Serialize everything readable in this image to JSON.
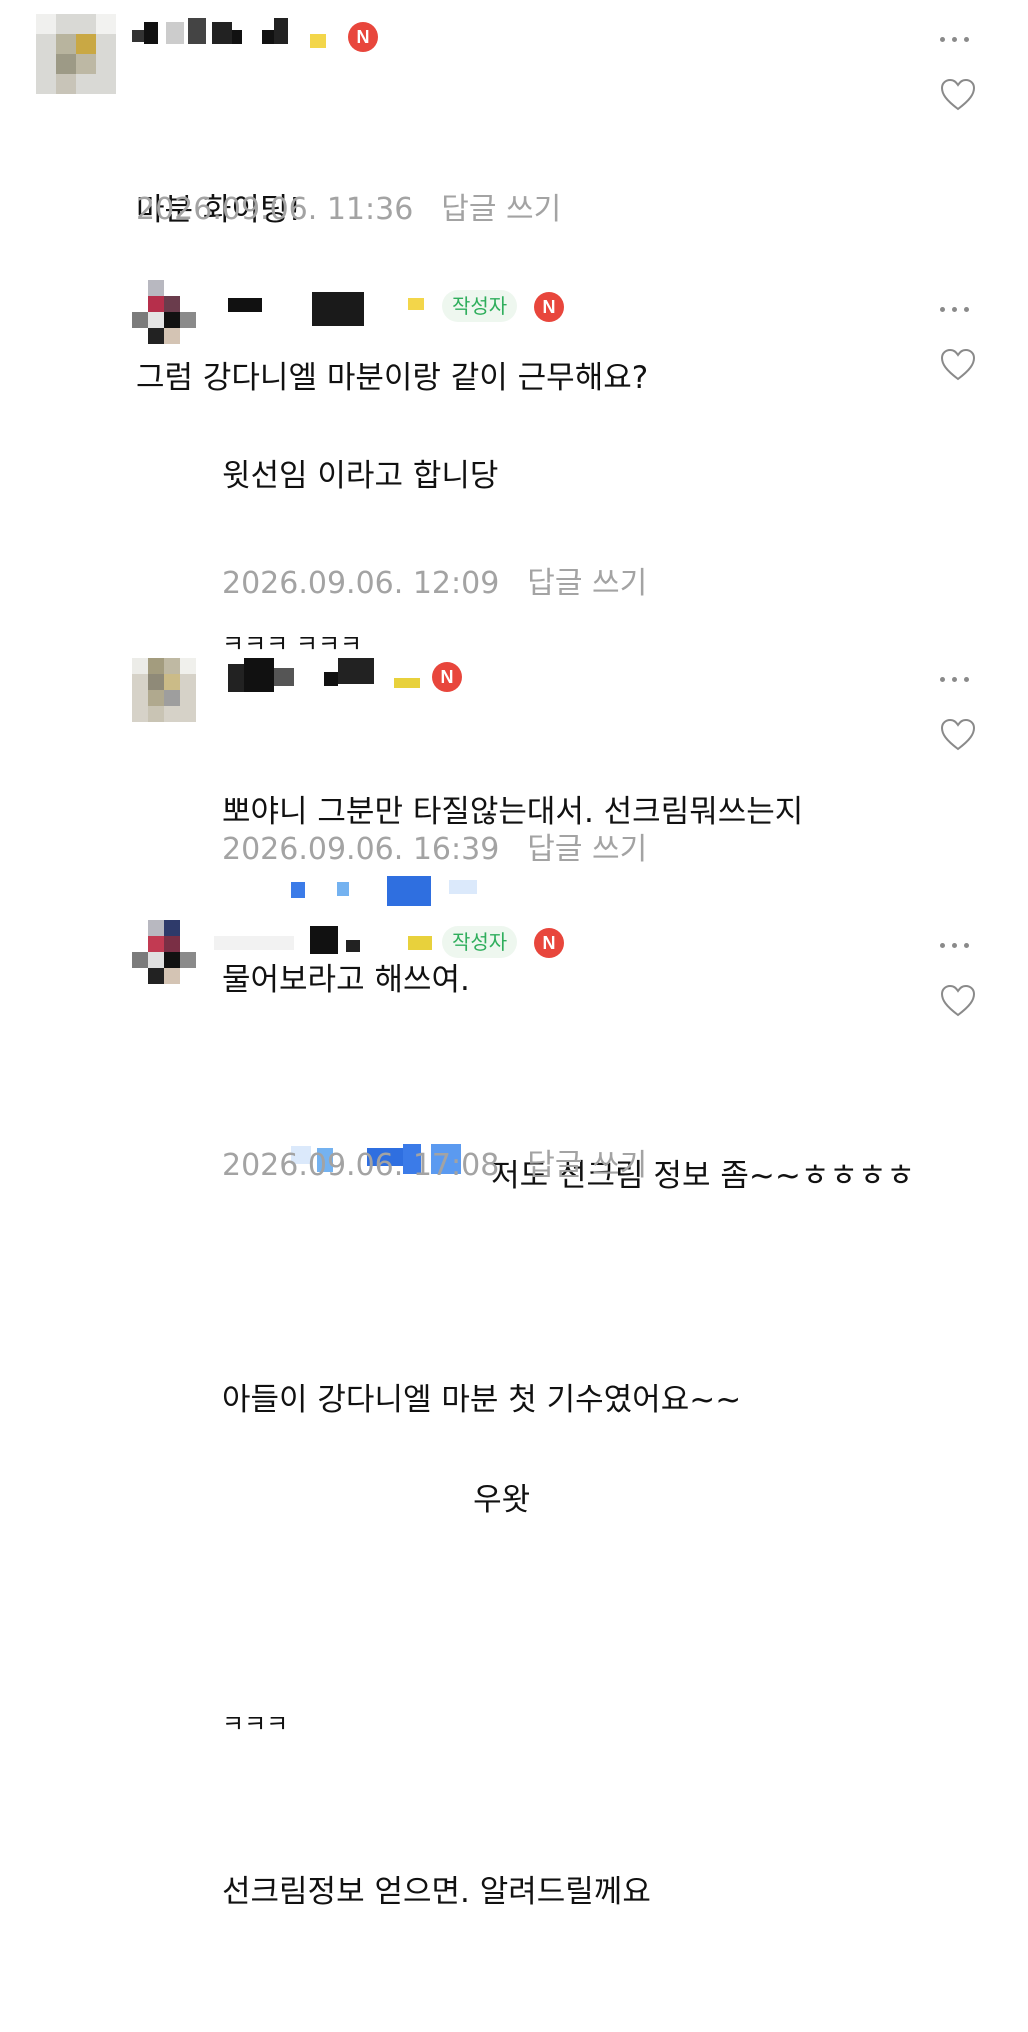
{
  "comments": [
    {
      "lines": [
        "마분 화이팅!",
        "그럼 강다니엘 마분이랑 같이 근무해요?"
      ],
      "timestamp": "2026.09.06. 11:36",
      "reply_label": "답글 쓰기",
      "n_badge": "N"
    },
    {
      "author_badge": "작성자",
      "lines": [
        "윗선임 이라고 합니당",
        "ㅋㅋㅋ ㅋㅋㅋ",
        "뽀야니 그분만 타질않는대서. 선크림뭐쓰는지",
        "물어보라고 해쓰여."
      ],
      "timestamp": "2026.09.06. 12:09",
      "reply_label": "답글 쓰기",
      "n_badge": "N"
    },
    {
      "lines": [
        "저도 선크림 정보 좀~~ㅎㅎㅎㅎ",
        "아들이 강다니엘 마분 첫 기수였어요~~"
      ],
      "timestamp": "2026.09.06. 16:39",
      "reply_label": "답글 쓰기",
      "n_badge": "N"
    },
    {
      "author_badge": "작성자",
      "lines": [
        "우왓",
        "ㅋㅋㅋ",
        "선크림정보 얻으면. 알려드릴께요"
      ],
      "timestamp": "2026.09.06. 17:08",
      "reply_label": "답글 쓰기",
      "n_badge": "N"
    }
  ],
  "icons": {
    "more": "more-icon",
    "like": "heart-icon",
    "badge": "naver-n-icon"
  },
  "colors": {
    "text": "#111111",
    "meta": "#a3a3a3",
    "author_badge_bg": "#eef7ef",
    "author_badge_text": "#2fae5c",
    "n_badge": "#e8463c",
    "mention": "#3b7be8"
  }
}
